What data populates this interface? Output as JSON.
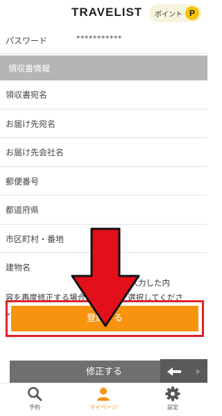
{
  "header": {
    "logo": "TRAVELIST",
    "points_label": "ポイント",
    "points_badge": "P"
  },
  "password": {
    "label": "パスワード",
    "value": "***********"
  },
  "receipt_section": {
    "title": "領収書情報",
    "fields": [
      {
        "label": "領収書宛名"
      },
      {
        "label": "お届け先宛名"
      },
      {
        "label": "お届け先会社名"
      },
      {
        "label": "郵便番号"
      },
      {
        "label": "都道府県"
      },
      {
        "label": "市区町村・番地"
      },
      {
        "label": "建物名"
      }
    ]
  },
  "notice": {
    "line1": "上 録します。入力した内",
    "line2": "容を再度修正する場合は「 る」を選択してくださ",
    "line3": "い。"
  },
  "buttons": {
    "register": "登録する",
    "modify": "修正する"
  },
  "nav": {
    "items": [
      {
        "label": "予約",
        "icon": "search-icon"
      },
      {
        "label": "マイページ",
        "icon": "person-icon",
        "active": true
      },
      {
        "label": "設定",
        "icon": "gear-icon"
      }
    ]
  },
  "colors": {
    "accent": "#f7930f",
    "highlight": "#e02028",
    "section_bg": "#b5b5b5",
    "points_badge": "#f5c400"
  }
}
